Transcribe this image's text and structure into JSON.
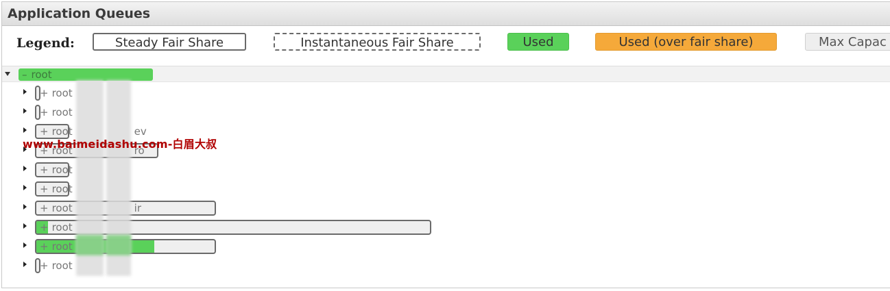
{
  "panel": {
    "title": "Application Queues"
  },
  "legend": {
    "label": "Legend:",
    "items": [
      {
        "label": "Steady Fair Share"
      },
      {
        "label": "Instantaneous Fair Share"
      },
      {
        "label": "Used",
        "color": "#5ad15a"
      },
      {
        "label": "Used (over fair share)",
        "color": "#f5a93a"
      },
      {
        "label": "Max Capac"
      }
    ]
  },
  "tree": {
    "root": {
      "expander": "–",
      "label": "root",
      "used_fraction": 1.0
    },
    "queues": [
      {
        "expander": "+",
        "label": "root",
        "suffix": "",
        "used_fraction": 0.0
      },
      {
        "expander": "+",
        "label": "root",
        "suffix": "",
        "used_fraction": 0.0
      },
      {
        "expander": "+",
        "label": "root",
        "suffix": "ev",
        "used_fraction": 0.0
      },
      {
        "expander": "+",
        "label": "root",
        "suffix": "ro",
        "used_fraction": 0.0
      },
      {
        "expander": "+",
        "label": "root",
        "suffix": "",
        "used_fraction": 0.0
      },
      {
        "expander": "+",
        "label": "root",
        "suffix": "",
        "used_fraction": 0.0
      },
      {
        "expander": "+",
        "label": "root",
        "suffix": "ir",
        "used_fraction": 0.0
      },
      {
        "expander": "+",
        "label": "root",
        "suffix": "",
        "used_fraction": 0.03
      },
      {
        "expander": "+",
        "label": "root",
        "suffix": "",
        "used_fraction": 0.66
      },
      {
        "expander": "+",
        "label": "root",
        "suffix": "",
        "used_fraction": 0.0
      }
    ]
  },
  "watermark": "www.baimeidashu.com-白眉大叔"
}
